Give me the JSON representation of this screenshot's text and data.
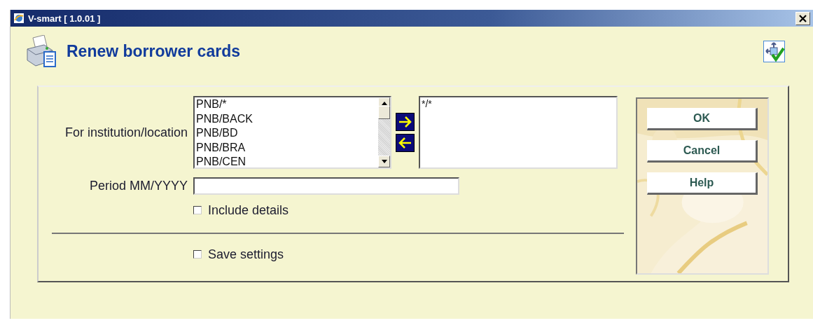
{
  "window": {
    "title": "V-smart [ 1.0.01 ]"
  },
  "page": {
    "title": "Renew borrower cards"
  },
  "form": {
    "location": {
      "label": "For institution/location",
      "available": [
        "PNB/*",
        "PNB/BACK",
        "PNB/BD",
        "PNB/BRA",
        "PNB/CEN"
      ],
      "chosen": [
        "*/*"
      ]
    },
    "period": {
      "label": "Period MM/YYYY"
    },
    "include_details": {
      "label": "Include details",
      "checked": false
    },
    "save_settings": {
      "label": "Save settings",
      "checked": false
    }
  },
  "buttons": [
    "OK",
    "Cancel",
    "Help"
  ]
}
